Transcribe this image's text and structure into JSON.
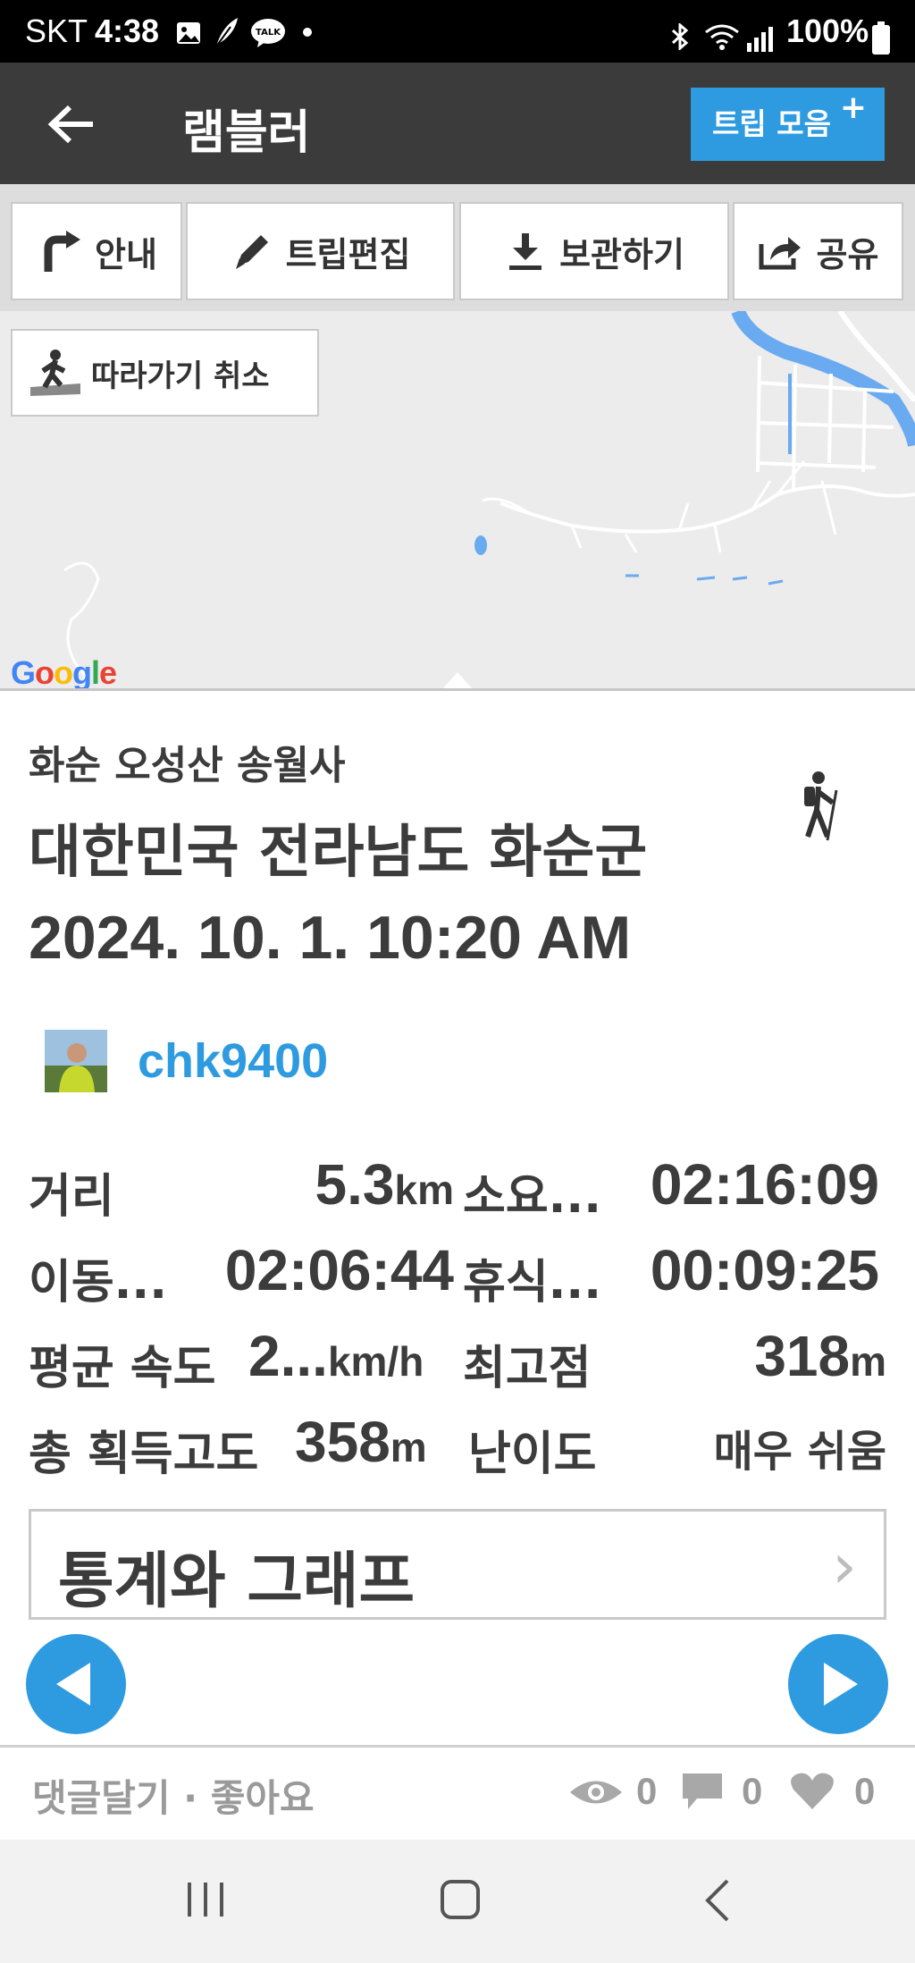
{
  "status_bar": {
    "carrier": "SKT",
    "time": "4:38",
    "battery": "100%",
    "icons": [
      "image-icon",
      "feather-icon",
      "talk-icon",
      "dot-icon",
      "bluetooth-icon",
      "wifi-icon",
      "signal-icon",
      "battery-icon"
    ],
    "talk_badge": "TALK"
  },
  "app_bar": {
    "title": "램블러",
    "trip_collection_button": "트립 모음",
    "trip_collection_plus": "+"
  },
  "toolbar": {
    "guide": "안내",
    "edit_trip": "트립편집",
    "save": "보관하기",
    "share": "공유"
  },
  "map": {
    "follow_cancel": "따라가기 취소",
    "google_logo": "Google",
    "colors": {
      "water": "#6aaaf0",
      "road": "#ffffff",
      "background": "#ececec"
    }
  },
  "trip": {
    "name": "화순 오성산 송월사",
    "region": "대한민국 전라남도 화순군",
    "datetime": "2024. 10. 1. 10:20 AM",
    "user": "chk9400",
    "activity_icon": "hiker-icon"
  },
  "stats": {
    "distance_label": "거리",
    "distance_value": "5.3",
    "distance_unit": "km",
    "duration_label": "소요...",
    "duration_value": "02:16:09",
    "moving_label": "이동...",
    "moving_value": "02:06:44",
    "rest_label": "휴식...",
    "rest_value": "00:09:25",
    "avg_speed_label": "평균 속도",
    "avg_speed_value": "2...",
    "avg_speed_unit": "km/h",
    "max_alt_label": "최고점",
    "max_alt_value": "318",
    "max_alt_unit": "m",
    "total_gain_label": "총 획득고도",
    "total_gain_value": "358",
    "total_gain_unit": "m",
    "difficulty_label": "난이도",
    "difficulty_value": "매우 쉬움"
  },
  "stats_graph_button": "통계와 그래프",
  "footer": {
    "comment_like": "댓글달기 · 좋아요",
    "views": "0",
    "comments": "0",
    "likes": "0"
  },
  "accent_color": "#2e9be0"
}
